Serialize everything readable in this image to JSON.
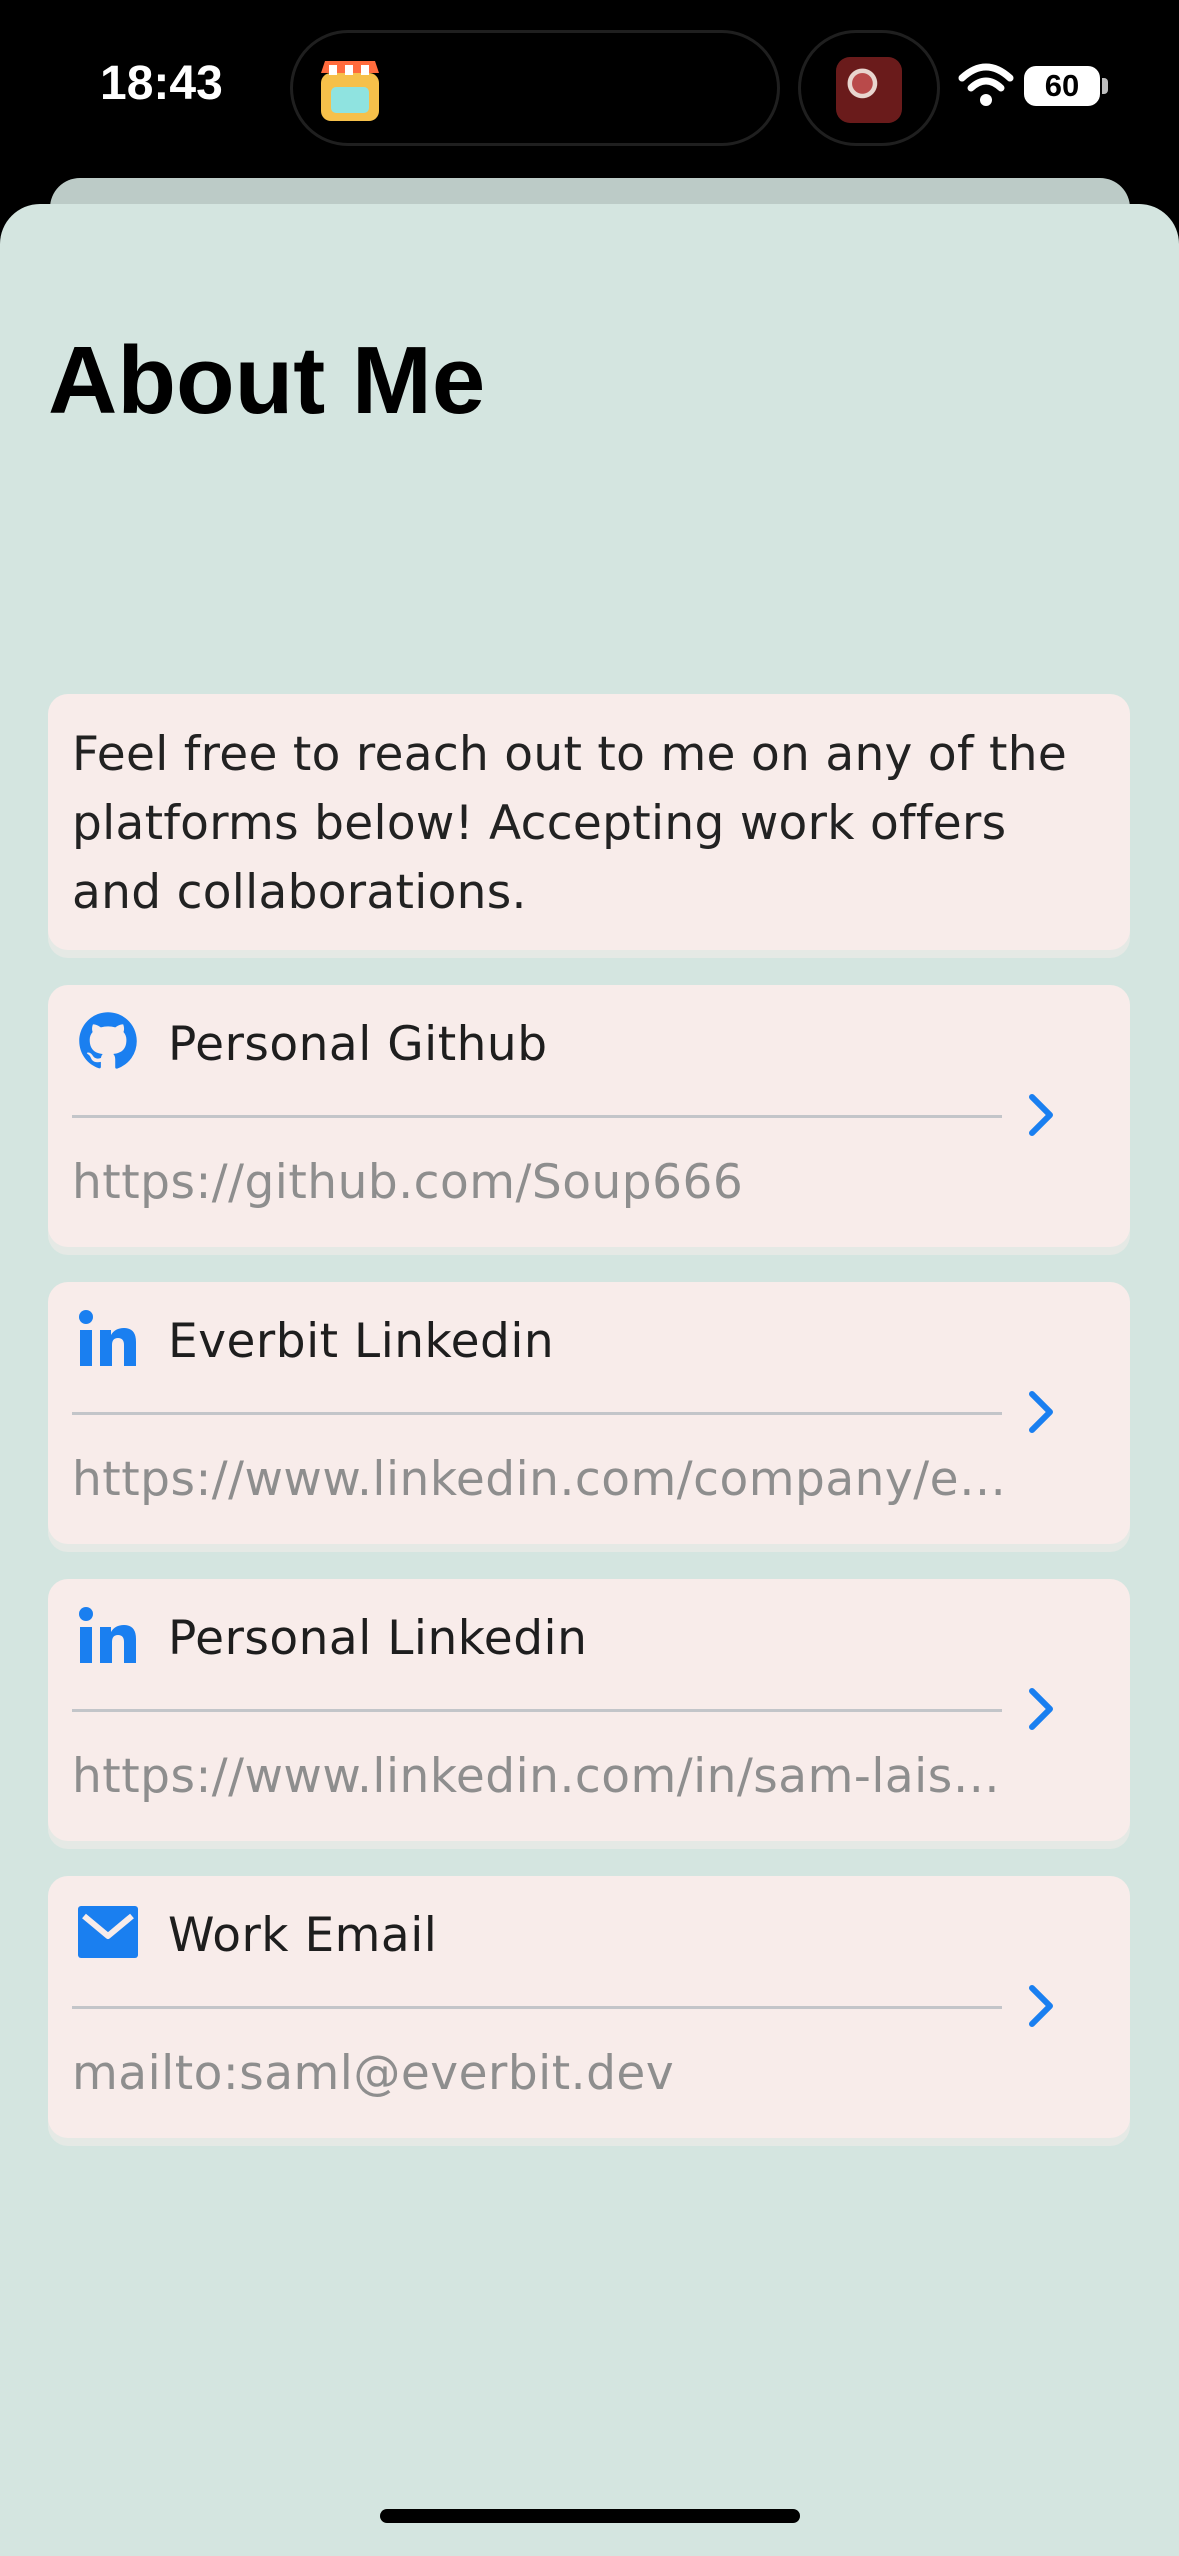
{
  "status_bar": {
    "time": "18:43",
    "battery": "60",
    "icons": [
      "shop-app-icon",
      "album-art-icon",
      "wifi-icon",
      "battery-icon"
    ]
  },
  "page": {
    "title": "About Me",
    "intro": "Feel free to reach out to me on any of the platforms below! Accepting work offers and collaborations."
  },
  "links": [
    {
      "title": "Personal Github",
      "url": "https://github.com/Soup666",
      "icon": "github-icon"
    },
    {
      "title": "Everbit Linkedin",
      "url": "https://www.linkedin.com/company/ev…",
      "icon": "linkedin-icon"
    },
    {
      "title": "Personal Linkedin",
      "url": "https://www.linkedin.com/in/sam-laist…",
      "icon": "linkedin-icon"
    },
    {
      "title": "Work Email",
      "url": "mailto:saml@everbit.dev",
      "icon": "mail-icon"
    }
  ],
  "colors": {
    "accent": "#1a7ff0",
    "sheet_background": "#d4e5e0",
    "card_background": "#f8ecea",
    "secondary_text": "#8e8e8e"
  }
}
